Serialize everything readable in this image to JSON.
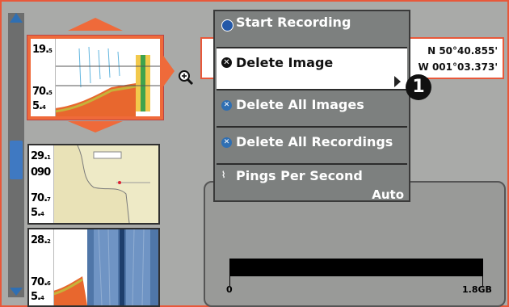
{
  "menu": {
    "items": [
      {
        "label": "Start Recording",
        "icon": "record-dot-icon",
        "active": false
      },
      {
        "label": "Delete Image",
        "icon": "delete-x-icon",
        "active": true
      },
      {
        "label": "Delete All Images",
        "icon": "delete-multi-icon",
        "active": false
      },
      {
        "label": "Delete All Recordings",
        "icon": "delete-multi-icon",
        "active": false
      },
      {
        "label": "Pings Per Second",
        "icon": "ping-icon",
        "active": false,
        "value": "Auto"
      }
    ]
  },
  "position": {
    "latitude": "N 50°40.855'",
    "longitude": "W 001°03.373'"
  },
  "storage": {
    "min_label": "0",
    "max_label": "1.8GB"
  },
  "callout": {
    "number": "1"
  },
  "thumbnails": [
    {
      "type": "sonar",
      "readings": [
        {
          "value": "19.",
          "sub": "5"
        },
        {
          "value": "70.",
          "sub": "5"
        },
        {
          "value": "5.",
          "sub": "4"
        }
      ]
    },
    {
      "type": "chart",
      "readings": [
        {
          "value": "29.",
          "sub": "1"
        },
        {
          "value": "090",
          "sub": ""
        },
        {
          "value": "70.",
          "sub": "7"
        },
        {
          "value": "5.",
          "sub": "4"
        }
      ]
    },
    {
      "type": "side-imaging",
      "readings": [
        {
          "value": "28.",
          "sub": "2"
        },
        {
          "value": "70.",
          "sub": "6"
        },
        {
          "value": "5.",
          "sub": "4"
        }
      ]
    }
  ],
  "colors": {
    "accent": "#ef6a3a",
    "menu_bg": "#7d807f",
    "scroll": "#3f79c2"
  }
}
